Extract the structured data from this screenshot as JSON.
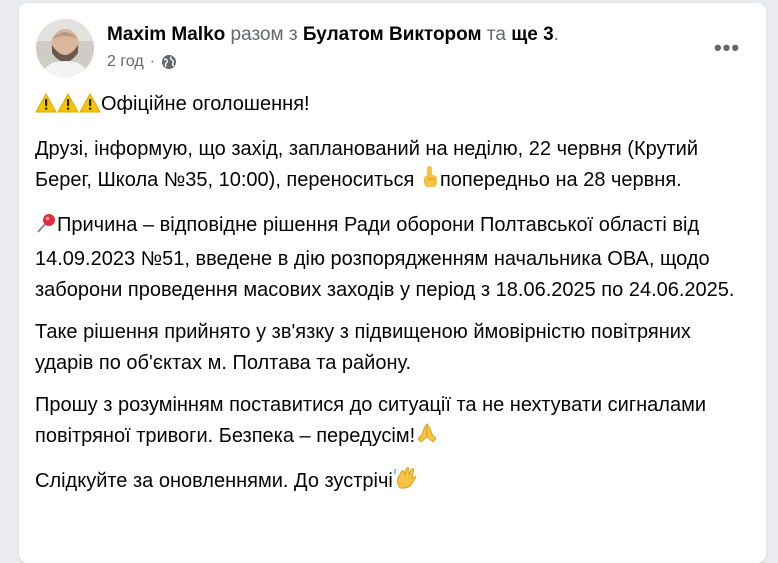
{
  "post": {
    "author": "Maxim Malko",
    "with_text": "разом з",
    "tagged": "Булатом Виктором",
    "and_text": "та",
    "others": "ще 3",
    "period": ".",
    "time": "2 год",
    "time_sep": "·",
    "privacy_icon": "globe-icon",
    "more_icon": "more-options-icon",
    "more_label": "•••",
    "paragraphs": [
      {
        "lead_icons": [
          "warning-icon",
          "warning-icon",
          "warning-icon"
        ],
        "text": "Офіційне оголошення!"
      },
      {
        "text_before": "Друзі, інформую, що захід, запланований на неділю, 22 червня (Крутий Берег, Школа №35, 10:00), переноситься ",
        "inline_icon": "pointing-up-icon",
        "text_after": "попередньо на 28 червня."
      },
      {
        "lead_icon": "pushpin-icon",
        "text": "Причина – відповідне рішення Ради оборони Полтавської області від 14.09.2023 №51, введене в дію розпорядженням начальника ОВА, щодо заборони проведення масових заходів у період з 18.06.2025 по 24.06.2025."
      },
      {
        "text": "Таке рішення прийнято у зв'язку з підвищеною ймовірністю повітряних ударів по об'єктах м. Полтава та району."
      },
      {
        "text": "Прошу з розумінням поставитися до ситуації та не нехтувати сигналами повітряної тривоги. Безпека – передусім!",
        "trail_icon": "folded-hands-icon"
      },
      {
        "text": "Слідкуйте за оновленнями. До зустрічі",
        "trail_icon": "waving-hand-icon"
      }
    ]
  }
}
